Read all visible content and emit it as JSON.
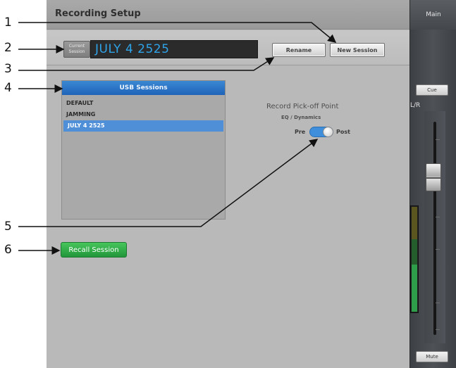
{
  "window": {
    "title": "Recording Setup"
  },
  "current_session": {
    "label_line1": "Current",
    "label_line2": "Session",
    "value": "JULY 4 2525"
  },
  "toolbar": {
    "rename_label": "Rename",
    "new_session_label": "New Session"
  },
  "usb_sessions": {
    "header": "USB Sessions",
    "items": [
      {
        "label": "DEFAULT",
        "selected": false
      },
      {
        "label": "JAMMING",
        "selected": false
      },
      {
        "label": "JULY 4 2525",
        "selected": true
      }
    ]
  },
  "pickoff": {
    "title": "Record Pick-off Point",
    "subtitle": "EQ / Dynamics",
    "pre_label": "Pre",
    "post_label": "Post",
    "value": "Post"
  },
  "recall_label": "Recall Session",
  "main_strip": {
    "header": "Main",
    "cue_label": "Cue",
    "lr_label": "L/R",
    "mute_label": "Mute"
  },
  "callouts": {
    "c1": "1",
    "c2": "2",
    "c3": "3",
    "c4": "4",
    "c5": "5",
    "c6": "6"
  },
  "colors": {
    "accent_blue": "#2ea3e8",
    "selected_blue": "#4f8fd8",
    "recall_green": "#2fae47",
    "panel_gray": "#b9b9b9"
  }
}
